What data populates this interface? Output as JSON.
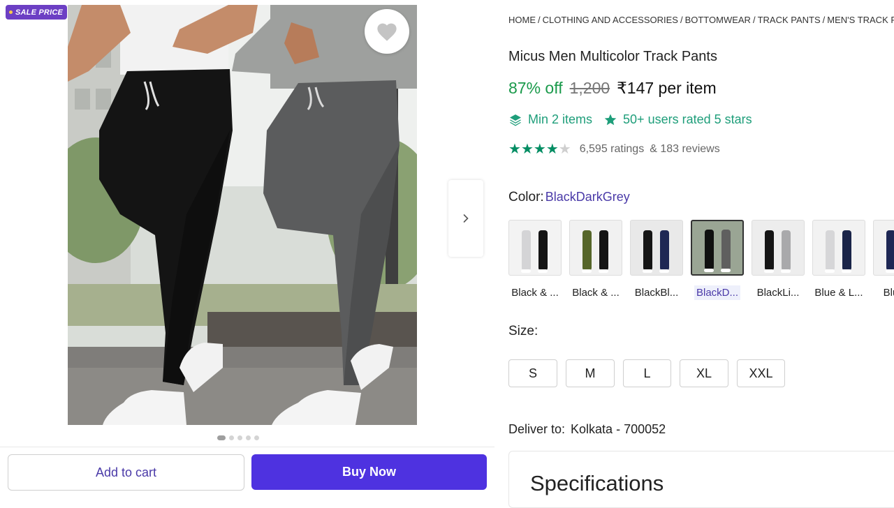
{
  "gallery": {
    "sale_badge": "SALE PRICE",
    "wishlist_icon": "heart-icon",
    "next_icon": "chevron-right-icon",
    "slide_count": 5,
    "active_slide": 1
  },
  "actions": {
    "add_to_cart": "Add to cart",
    "buy_now": "Buy Now"
  },
  "breadcrumb": [
    "HOME",
    "CLOTHING AND ACCESSORIES",
    "BOTTOMWEAR",
    "TRACK PANTS",
    "MEN'S TRACK PANTS"
  ],
  "product": {
    "title": "Micus Men Multicolor Track Pants",
    "discount": "87% off",
    "mrp": "1,200",
    "price": "₹147 per item",
    "min_items": "Min 2 items",
    "rated_badge": "50+ users rated 5 stars",
    "rating_value": 4,
    "rating_max": 5,
    "ratings_count": "6,595 ratings",
    "reviews_count": "& 183 reviews"
  },
  "color": {
    "label": "Color:",
    "selected": "BlackDarkGrey",
    "options": [
      {
        "name": "Black & ...",
        "leg1": "#d4d4d6",
        "leg2": "#141414",
        "bg": "#f3f3f3"
      },
      {
        "name": "Black & ...",
        "leg1": "#56662a",
        "leg2": "#151515",
        "bg": "#f1f1f1"
      },
      {
        "name": "BlackBl...",
        "leg1": "#151515",
        "leg2": "#1e2754",
        "bg": "#e9e9e9"
      },
      {
        "name": "BlackD...",
        "leg1": "#101010",
        "leg2": "#5f5f5f",
        "bg": "#9aa594"
      },
      {
        "name": "BlackLi...",
        "leg1": "#151515",
        "leg2": "#a9a9ab",
        "bg": "#ededed"
      },
      {
        "name": "Blue & L...",
        "leg1": "#d6d6d8",
        "leg2": "#1a2448",
        "bg": "#f2f2f2"
      },
      {
        "name": "Blue ...",
        "leg1": "#1e2754",
        "leg2": "#1e2754",
        "bg": "#f2f2f2"
      }
    ]
  },
  "size": {
    "label": "Size:",
    "options": [
      "S",
      "M",
      "L",
      "XL",
      "XXL"
    ]
  },
  "delivery": {
    "label": "Deliver to:",
    "location": "Kolkata - 700052"
  },
  "specifications": {
    "title": "Specifications"
  },
  "colors": {
    "accent": "#4e32e0",
    "discount_green": "#1a9a4b",
    "feature_teal": "#1e9e7a",
    "star_green": "#038d63",
    "sale_purple": "#6c3fc4"
  }
}
